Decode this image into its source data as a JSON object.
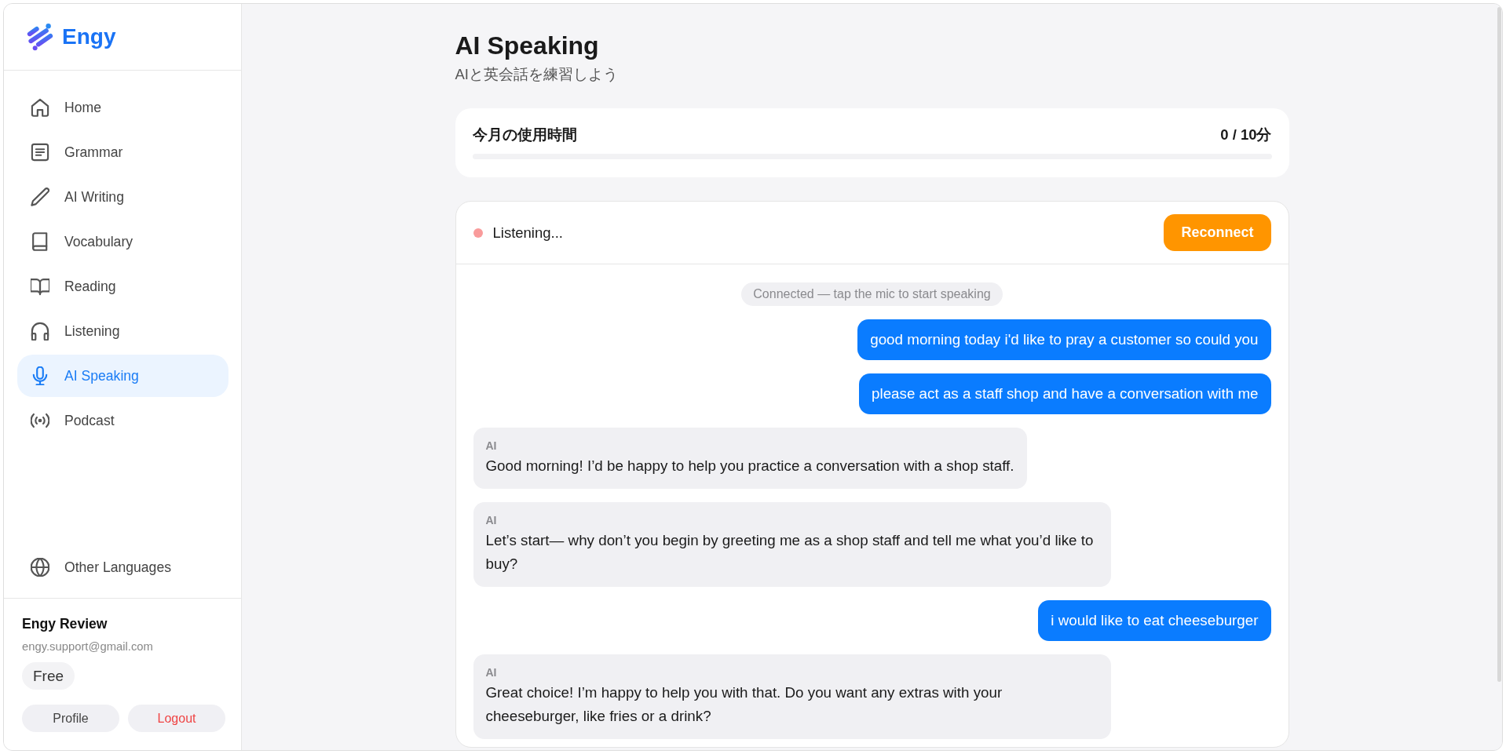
{
  "sidebar": {
    "logo": "Engy",
    "nav": [
      {
        "label": "Home",
        "selected": false
      },
      {
        "label": "Grammar",
        "selected": false
      },
      {
        "label": "AI Writing",
        "selected": false
      },
      {
        "label": "Vocabulary",
        "selected": false
      },
      {
        "label": "Reading",
        "selected": false
      },
      {
        "label": "Listening",
        "selected": false
      },
      {
        "label": "AI Speaking",
        "selected": true
      },
      {
        "label": "Podcast",
        "selected": false
      }
    ],
    "footer_nav": [
      {
        "label": "Other Languages",
        "selected": false
      }
    ],
    "user": {
      "name": "Engy Review",
      "email": "engy.support@gmail.com",
      "plan": "Free",
      "buttons": [
        {
          "label": "Profile",
          "kind": "default"
        },
        {
          "label": "Logout",
          "kind": "danger"
        }
      ]
    }
  },
  "header": {
    "title": "AI Speaking",
    "subtitle": "AIと英会話を練習しよう"
  },
  "usage": {
    "label": "今月の使用時間",
    "reading": "0 / 10分",
    "level": 0
  },
  "session": {
    "status": {
      "label": "Listening...",
      "color": "#f99b9b"
    },
    "button": "Reconnect",
    "messages": [
      {
        "kind": "system",
        "text": "Connected — tap the mic to start speaking"
      },
      {
        "kind": "user",
        "text": "good morning today i'd like to pray a customer so could you"
      },
      {
        "kind": "user",
        "text": "please act as a staff shop and have a conversation with me"
      },
      {
        "kind": "ai",
        "sender": "AI",
        "text": "Good morning! I’d be happy to help you practice a conversation with a shop staff."
      },
      {
        "kind": "ai",
        "sender": "AI",
        "text": "Let’s start— why don’t you begin by greeting me as a shop staff and tell me what you’d like to buy?"
      },
      {
        "kind": "user",
        "text": "i would like to eat cheeseburger"
      },
      {
        "kind": "ai",
        "sender": "AI",
        "text": "Great choice! I’m happy to help you with that. Do you want any extras with your cheeseburger, like fries or a drink?"
      }
    ]
  }
}
